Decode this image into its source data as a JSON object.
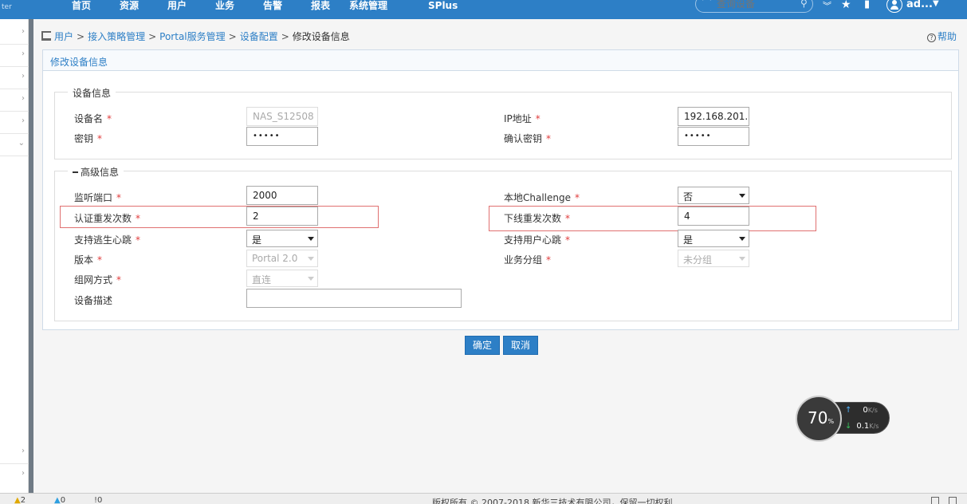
{
  "topbar": {
    "brand": "ter",
    "nav": [
      "首页",
      "资源",
      "用户",
      "业务",
      "告警",
      "报表",
      "系统管理",
      "SPlus"
    ],
    "search_placeholder": "查询设备",
    "username": "ad..."
  },
  "breadcrumb": {
    "items": [
      "用户",
      "接入策略管理",
      "Portal服务管理",
      "设备配置"
    ],
    "current": "修改设备信息",
    "help": "帮助"
  },
  "panel": {
    "title": "修改设备信息"
  },
  "device_info": {
    "legend": "设备信息",
    "device_name_label": "设备名",
    "device_name_value": "NAS_S12508",
    "ip_label": "IP地址",
    "ip_value": "192.168.201.",
    "key_label": "密钥",
    "key_value": "•••••",
    "confirm_key_label": "确认密钥",
    "confirm_key_value": "•••••"
  },
  "advanced_info": {
    "legend": "高级信息",
    "listen_port_label": "监听端口",
    "listen_port_value": "2000",
    "local_challenge_label": "本地Challenge",
    "local_challenge_value": "否",
    "auth_retry_label": "认证重发次数",
    "auth_retry_value": "2",
    "offline_retry_label": "下线重发次数",
    "offline_retry_value": "4",
    "escape_heartbeat_label": "支持逃生心跳",
    "escape_heartbeat_value": "是",
    "user_heartbeat_label": "支持用户心跳",
    "user_heartbeat_value": "是",
    "version_label": "版本",
    "version_value": "Portal 2.0",
    "service_group_label": "业务分组",
    "service_group_value": "未分组",
    "network_mode_label": "组网方式",
    "network_mode_value": "直连",
    "description_label": "设备描述",
    "description_value": ""
  },
  "required_mark": "*",
  "buttons": {
    "ok": "确定",
    "cancel": "取消"
  },
  "speed_widget": {
    "percent": "70",
    "percent_sign": "%",
    "up_value": "0",
    "down_value": "0.1",
    "unit": "K/s"
  },
  "footer": {
    "alarm_1": "2",
    "alarm_2": "0",
    "alarm_3": "0",
    "copyright": "版权所有 © 2007-2018 新华三技术有限公司，保留一切权利"
  }
}
